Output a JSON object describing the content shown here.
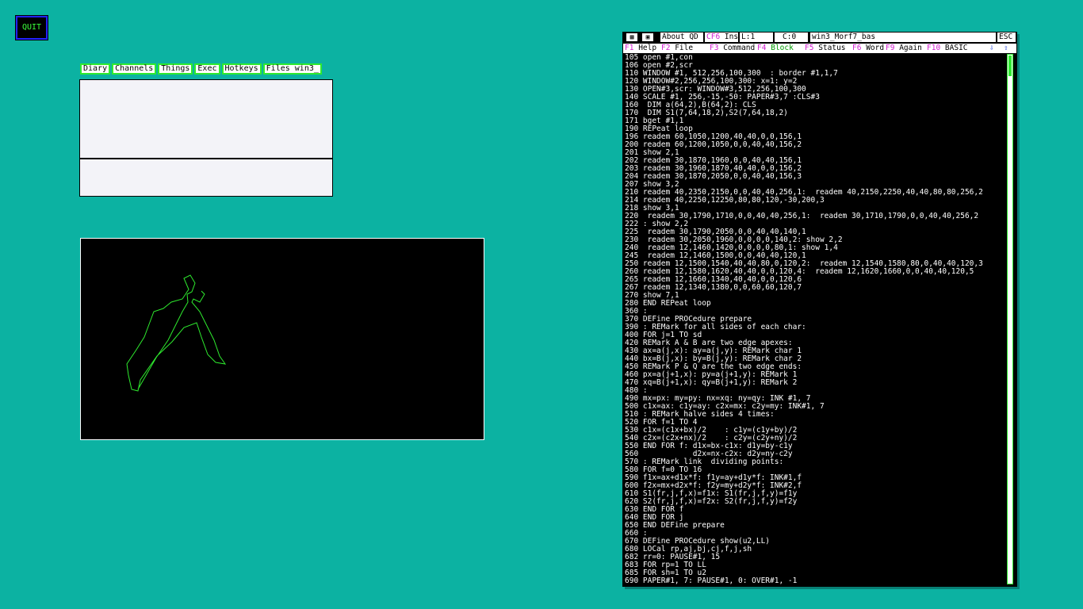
{
  "quit_label": "QUIT",
  "menu": [
    "Diary",
    "Channels",
    "Things",
    "Exec",
    "Hotkeys",
    "Files win3_"
  ],
  "editor": {
    "about": "About QD",
    "cf6": "CF6",
    "mode": "Ins",
    "line": "L:1",
    "col": "C:0",
    "filename": "win3_Morf7_bas",
    "esc": "ESC",
    "fkeys": [
      {
        "key": "F1",
        "label": "Help"
      },
      {
        "key": "F2",
        "label": "File"
      },
      {
        "key": "F3",
        "label": "Command"
      },
      {
        "key": "F4",
        "label": "Block"
      },
      {
        "key": "F5",
        "label": "Status"
      },
      {
        "key": "F6",
        "label": "Word"
      },
      {
        "key": "F9",
        "label": "Again"
      },
      {
        "key": "F10",
        "label": "BASIC"
      }
    ],
    "code": [
      "105 open #1,con",
      "106 open #2,scr",
      "110 WINDOW #1, 512,256,100,300  : border #1,1,7",
      "120 WINDOW#2,256,256,100,300: x=1: y=2",
      "130 OPEN#3,scr: WINDOW#3,512,256,100,300",
      "140 SCALE #1, 256,-15,-50: PAPER#3,7 :CLS#3",
      "160  DIM a(64,2),B(64,2): CLS",
      "170  DIM S1(7,64,18,2),S2(7,64,18,2)",
      "171 bget #1,1",
      "190 REPeat loop",
      "196 readem 60,1050,1200,40,40,0,0,156,1",
      "200 readem 60,1200,1050,0,0,40,40,156,2",
      "201 show 2,1",
      "202 readem 30,1870,1960,0,0,40,40,156,1",
      "203 readem 30,1960,1870,40,40,0,0,156,2",
      "204 readem 30,1870,2050,0,0,40,40,156,3",
      "207 show 3,2",
      "210 readem 40,2350,2150,0,0,40,40,256,1:  readem 40,2150,2250,40,40,80,80,256,2",
      "214 readem 40,2250,12250,80,80,120,-30,200,3",
      "218 show 3,1",
      "220  readem 30,1790,1710,0,0,40,40,256,1:  readem 30,1710,1790,0,0,40,40,256,2",
      "222 : show 2,2",
      "225  readem 30,1790,2050,0,0,40,40,140,1",
      "230  readem 30,2050,1960,0,0,0,0,140,2: show 2,2",
      "240  readem 12,1460,1420,0,0,0,0,80,1: show 1,4",
      "245  readem 12,1460,1500,0,0,40,40,120,1",
      "250 readem 12,1500,1540,40,40,80,0,120,2:  readem 12,1540,1580,80,0,40,40,120,3",
      "260 readem 12,1580,1620,40,40,0,0,120,4:  readem 12,1620,1660,0,0,40,40,120,5",
      "265 readem 12,1660,1340,40,40,0,0,120,6",
      "267 readem 12,1340,1380,0,0,60,60,120,7",
      "270 show 7,1",
      "280 END REPeat loop",
      "360 :",
      "370 DEFine PROCedure prepare",
      "390 : REMark for all sides of each char:",
      "400 FOR j=1 TO sd",
      "420 REMark A & B are two edge apexes:",
      "430 ax=a(j,x): ay=a(j,y): REMark char 1",
      "440 bx=B(j,x): by=B(j,y): REMark char 2",
      "450 REMark P & Q are the two edge ends:",
      "460 px=a(j+1,x): py=a(j+1,y): REMark 1",
      "470 xq=B(j+1,x): qy=B(j+1,y): REMark 2",
      "480 :",
      "490 mx=px: my=py: nx=xq: ny=qy: INK #1, 7",
      "500 c1x=ax: c1y=ay: c2x=mx: c2y=my: INK#1, 7",
      "510 : REMark halve sides 4 times:",
      "520 FOR f=1 TO 4",
      "530 c1x=(c1x+bx)/2    : c1y=(c1y+by)/2",
      "540 c2x=(c2x+nx)/2    : c2y=(c2y+ny)/2",
      "550 END FOR f: d1x=bx-c1x: d1y=by-c1y",
      "560            d2x=nx-c2x: d2y=ny-c2y",
      "570 : REMark link  dividing points:",
      "580 FOR f=0 TO 16",
      "590 f1x=ax+d1x*f: f1y=ay+d1y*f: INK#1,f",
      "600 f2x=mx+d2x*f: f2y=my+d2y*f: INK#2,f",
      "610 S1(fr,j,f,x)=f1x: S1(fr,j,f,y)=f1y",
      "620 S2(fr,j,f,x)=f2x: S2(fr,j,f,y)=f2y",
      "630 END FOR f",
      "640 END FOR j",
      "650 END DEFine prepare",
      "660 :",
      "670 DEFine PROCedure show(u2,LL)",
      "680 LOCal rp,aj,bj,cj,f,j,sh",
      "682 rr=0: PAUSE#1, 15",
      "683 FOR rp=1 TO LL",
      "685 FOR sh=1 TO u2",
      "690 PAPER#1, 7: PAUSE#1, 0: OVER#1, -1"
    ]
  }
}
